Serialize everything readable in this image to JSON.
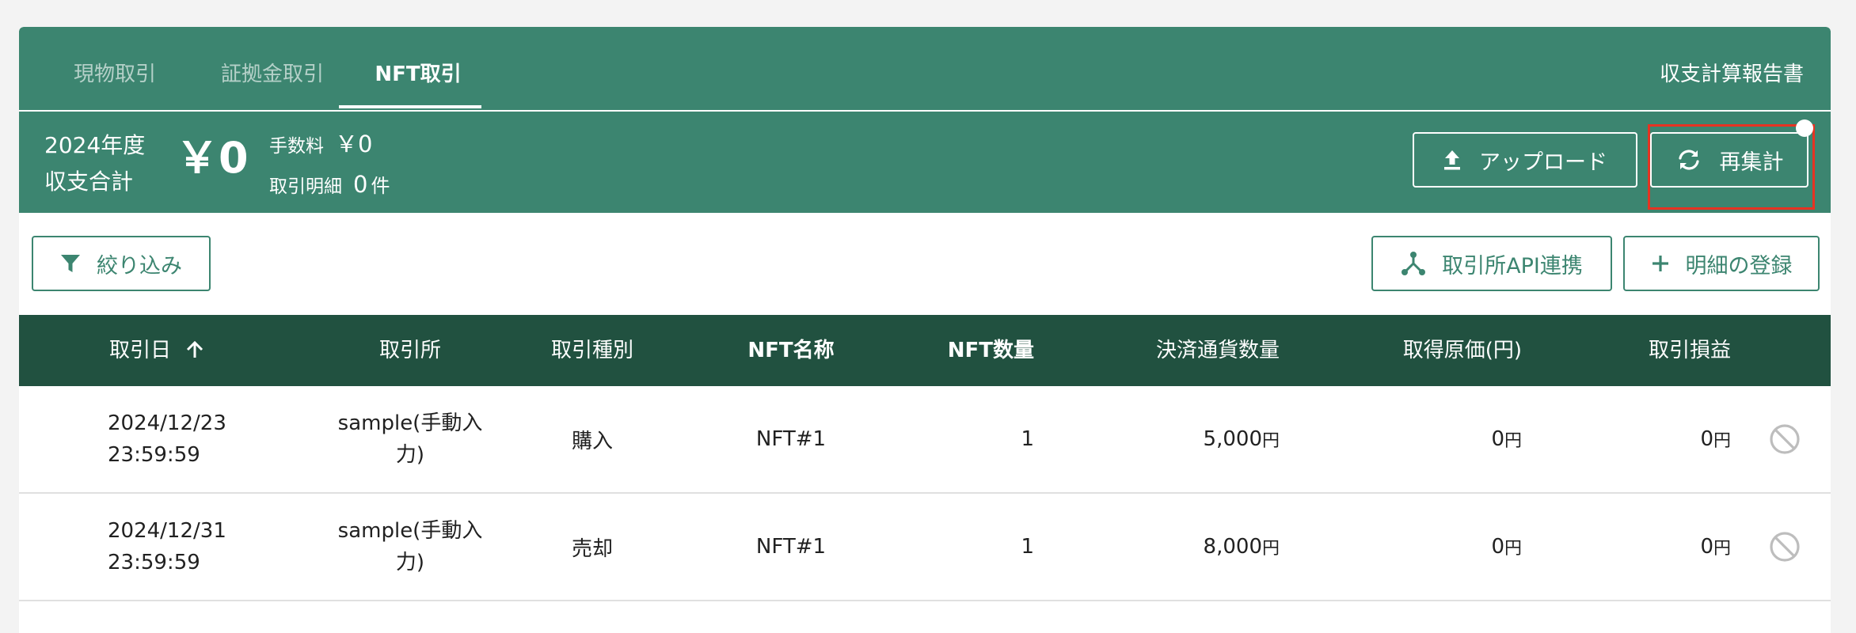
{
  "tabs": [
    {
      "label": "現物取引"
    },
    {
      "label": "証拠金取引"
    },
    {
      "label": "NFT取引"
    }
  ],
  "report_link": "収支計算報告書",
  "summary": {
    "year_label": "2024年度",
    "total_label": "収支合計",
    "total_value": "￥0",
    "fee_label": "手数料",
    "fee_value": "￥0",
    "detail_label": "取引明細",
    "detail_count": "0",
    "detail_unit": "件",
    "upload_button": "アップロード",
    "recalc_button": "再集計"
  },
  "toolbar": {
    "filter_button": "絞り込み",
    "api_button": "取引所API連携",
    "add_button": "明細の登録"
  },
  "table": {
    "headers": {
      "date": "取引日",
      "exchange": "取引所",
      "type": "取引種別",
      "nft_name": "NFT名称",
      "nft_qty": "NFT数量",
      "settle_qty": "決済通貨数量",
      "cost": "取得原価(円)",
      "pnl": "取引損益"
    },
    "yen_unit": "円",
    "rows": [
      {
        "date": "2024/12/23",
        "time": "23:59:59",
        "exchange_line1": "sample(手動入",
        "exchange_line2": "力)",
        "type": "購入",
        "nft_name": "NFT#1",
        "nft_qty": "1",
        "settle_qty": "5,000",
        "cost": "0",
        "pnl": "0"
      },
      {
        "date": "2024/12/31",
        "time": "23:59:59",
        "exchange_line1": "sample(手動入",
        "exchange_line2": "力)",
        "type": "売却",
        "nft_name": "NFT#1",
        "nft_qty": "1",
        "settle_qty": "8,000",
        "cost": "0",
        "pnl": "0"
      }
    ]
  },
  "colors": {
    "brand_green": "#3c8570",
    "header_dark_green": "#215140",
    "highlight_red": "#e63322"
  },
  "icons": [
    "upload-icon",
    "refresh-icon",
    "filter-icon",
    "api-link-icon",
    "plus-icon",
    "sort-ascending-icon",
    "disable-icon"
  ]
}
